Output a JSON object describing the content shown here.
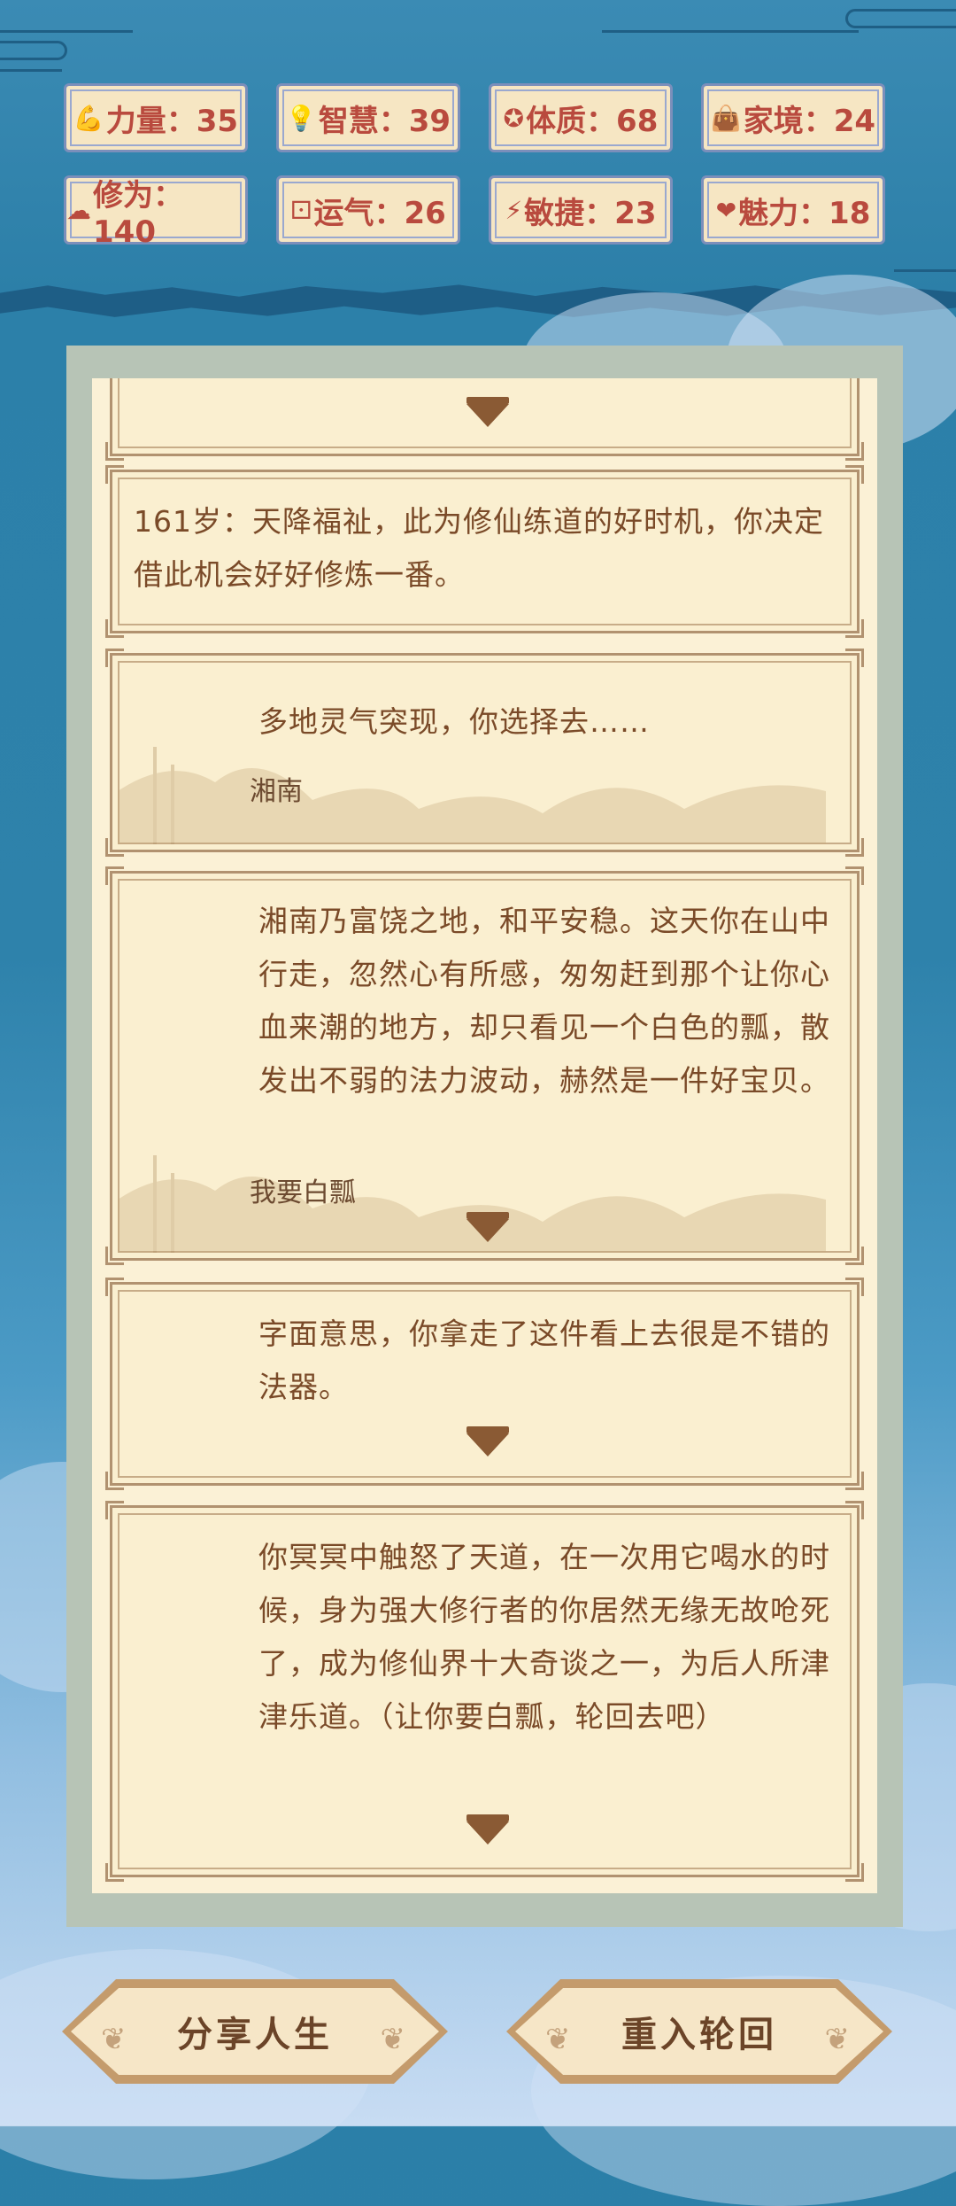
{
  "stats": [
    {
      "icon": "arm-icon",
      "glyph": "💪",
      "label": "力量：35"
    },
    {
      "icon": "bulb-icon",
      "glyph": "💡",
      "label": "智慧：39"
    },
    {
      "icon": "body-icon",
      "glyph": "✪",
      "label": "体质：68"
    },
    {
      "icon": "money-bag-icon",
      "glyph": "👜",
      "label": "家境：24"
    },
    {
      "icon": "cloud-icon",
      "glyph": "☁",
      "label": "修为：140"
    },
    {
      "icon": "dice-icon",
      "glyph": "⚀",
      "label": "运气：26"
    },
    {
      "icon": "lightning-icon",
      "glyph": "⚡",
      "label": "敏捷：23"
    },
    {
      "icon": "heart-icon",
      "glyph": "❤",
      "label": "魅力：18"
    }
  ],
  "events": [
    {
      "text": ""
    },
    {
      "text": "161岁：天降福祉，此为修仙练道的好时机，你决定借此机会好好修炼一番。"
    },
    {
      "text": "多地灵气突现，你选择去……",
      "choice": "湘南"
    },
    {
      "text": "湘南乃富饶之地，和平安稳。这天你在山中行走，忽然心有所感，匆匆赶到那个让你心血来潮的地方，却只看见一个白色的瓢，散发出不弱的法力波动，赫然是一件好宝贝。",
      "choice": "我要白瓢"
    },
    {
      "text": "字面意思，你拿走了这件看上去很是不错的法器。"
    },
    {
      "text": "你冥冥中触怒了天道，在一次用它喝水的时候，身为强大修行者的你居然无缘无故呛死了，成为修仙界十大奇谈之一，为后人所津津乐道。（让你要白瓢，轮回去吧）"
    }
  ],
  "buttons": {
    "share": "分享人生",
    "reincarnate": "重入轮回"
  },
  "colors": {
    "stat_text": "#b94a3e",
    "card_text": "#7a4a28",
    "button_text": "#6b4428"
  }
}
